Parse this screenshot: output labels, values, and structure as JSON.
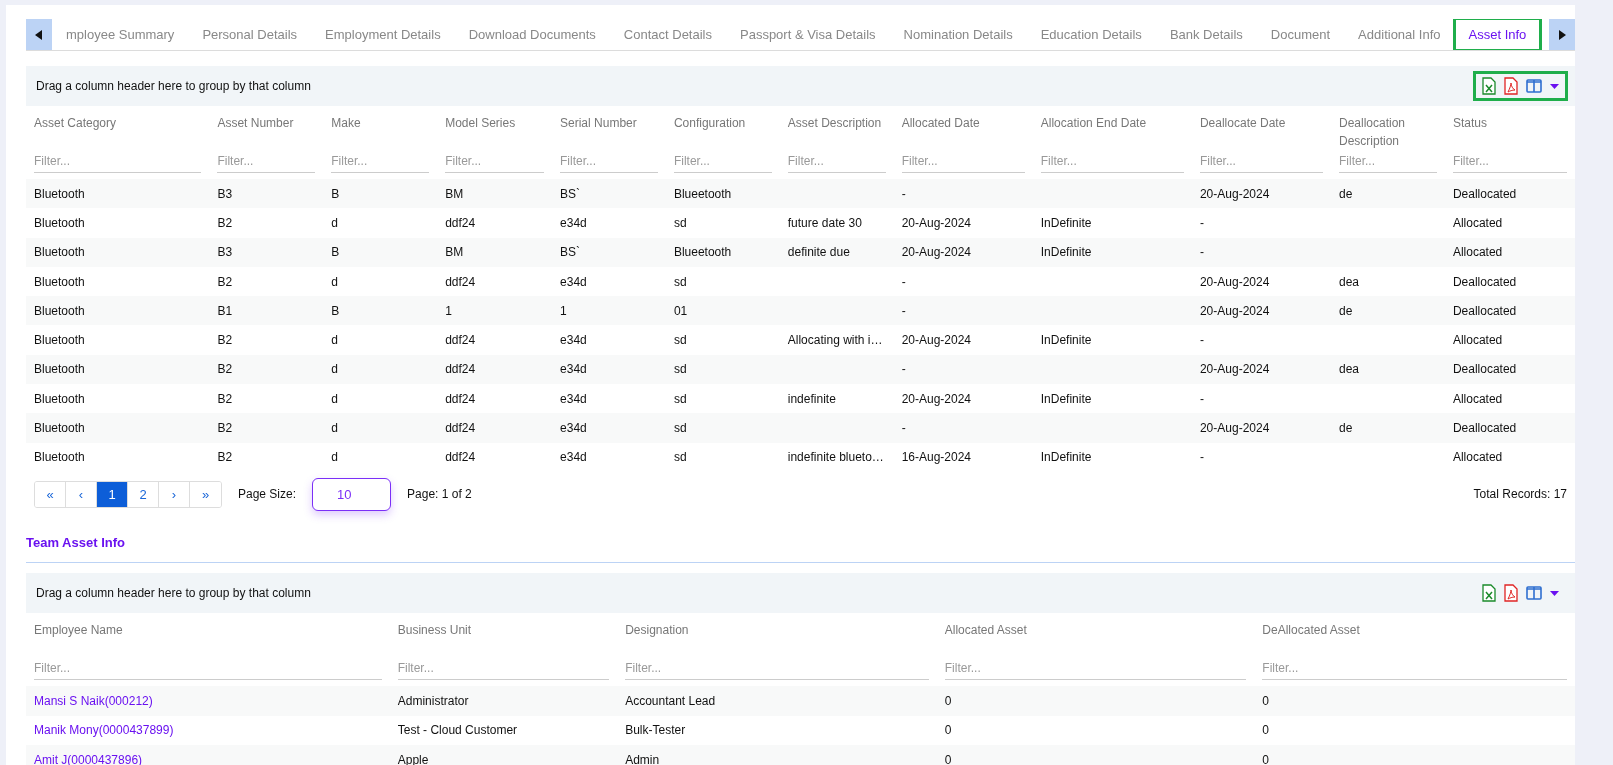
{
  "tabs": {
    "items": [
      {
        "label": "mployee Summary",
        "selected": false,
        "highlighted": false
      },
      {
        "label": "Personal Details",
        "selected": false,
        "highlighted": false
      },
      {
        "label": "Employment Details",
        "selected": false,
        "highlighted": false
      },
      {
        "label": "Download Documents",
        "selected": false,
        "highlighted": false
      },
      {
        "label": "Contact Details",
        "selected": false,
        "highlighted": false
      },
      {
        "label": "Passport & Visa Details",
        "selected": false,
        "highlighted": false
      },
      {
        "label": "Nomination Details",
        "selected": false,
        "highlighted": false
      },
      {
        "label": "Education Details",
        "selected": false,
        "highlighted": false
      },
      {
        "label": "Bank Details",
        "selected": false,
        "highlighted": false
      },
      {
        "label": "Document",
        "selected": false,
        "highlighted": false
      },
      {
        "label": "Additional Info",
        "selected": false,
        "highlighted": false
      },
      {
        "label": "Asset Info",
        "selected": true,
        "highlighted": true
      }
    ]
  },
  "asset_grid": {
    "group_hint": "Drag a column header here to group by that column",
    "toolbar": {
      "highlighted": true
    },
    "columns": [
      {
        "label": "Asset Category",
        "filter_placeholder": "Filter..."
      },
      {
        "label": "Asset Number",
        "filter_placeholder": "Filter..."
      },
      {
        "label": "Make",
        "filter_placeholder": "Filter..."
      },
      {
        "label": "Model Series",
        "filter_placeholder": "Filter..."
      },
      {
        "label": "Serial Number",
        "filter_placeholder": "Filter..."
      },
      {
        "label": "Configuration",
        "filter_placeholder": "Filter..."
      },
      {
        "label": "Asset Description",
        "filter_placeholder": "Filter..."
      },
      {
        "label": "Allocated Date",
        "filter_placeholder": "Filter..."
      },
      {
        "label": "Allocation End Date",
        "filter_placeholder": "Filter..."
      },
      {
        "label": "Deallocate Date",
        "filter_placeholder": "Filter..."
      },
      {
        "label": "Deallocation Description",
        "filter_placeholder": "Filter..."
      },
      {
        "label": "Status",
        "filter_placeholder": "Filter..."
      }
    ],
    "rows": [
      [
        "Bluetooth",
        "B3",
        "B",
        "BM",
        "BS`",
        "Blueetooth",
        "",
        "-",
        "",
        "20-Aug-2024",
        "de",
        "Deallocated"
      ],
      [
        "Bluetooth",
        "B2",
        "d",
        "ddf24",
        "e34d",
        "sd",
        "future date 30",
        "20-Aug-2024",
        "InDefinite",
        "-",
        "",
        "Allocated"
      ],
      [
        "Bluetooth",
        "B3",
        "B",
        "BM",
        "BS`",
        "Blueetooth",
        "definite due",
        "20-Aug-2024",
        "InDefinite",
        "-",
        "",
        "Allocated"
      ],
      [
        "Bluetooth",
        "B2",
        "d",
        "ddf24",
        "e34d",
        "sd",
        "",
        "-",
        "",
        "20-Aug-2024",
        "dea",
        "Deallocated"
      ],
      [
        "Bluetooth",
        "B1",
        "B",
        "1",
        "1",
        "01",
        "",
        "-",
        "",
        "20-Aug-2024",
        "de",
        "Deallocated"
      ],
      [
        "Bluetooth",
        "B2",
        "d",
        "ddf24",
        "e34d",
        "sd",
        "Allocating with i…",
        "20-Aug-2024",
        "InDefinite",
        "-",
        "",
        "Allocated"
      ],
      [
        "Bluetooth",
        "B2",
        "d",
        "ddf24",
        "e34d",
        "sd",
        "",
        "-",
        "",
        "20-Aug-2024",
        "dea",
        "Deallocated"
      ],
      [
        "Bluetooth",
        "B2",
        "d",
        "ddf24",
        "e34d",
        "sd",
        "indefinite",
        "20-Aug-2024",
        "InDefinite",
        "-",
        "",
        "Allocated"
      ],
      [
        "Bluetooth",
        "B2",
        "d",
        "ddf24",
        "e34d",
        "sd",
        "",
        "-",
        "",
        "20-Aug-2024",
        "de",
        "Deallocated"
      ],
      [
        "Bluetooth",
        "B2",
        "d",
        "ddf24",
        "e34d",
        "sd",
        "indefinite blueto…",
        "16-Aug-2024",
        "InDefinite",
        "-",
        "",
        "Allocated"
      ]
    ],
    "pagination": {
      "buttons": [
        {
          "label": "«",
          "selected": false
        },
        {
          "label": "‹",
          "selected": false
        },
        {
          "label": "1",
          "selected": true
        },
        {
          "label": "2",
          "selected": false
        },
        {
          "label": "›",
          "selected": false
        },
        {
          "label": "»",
          "selected": false
        }
      ],
      "page_size_label": "Page Size:",
      "page_size": "10",
      "page_info": "Page: 1 of 2",
      "total": "Total Records: 17"
    }
  },
  "team_section": {
    "title": "Team Asset Info"
  },
  "team_grid": {
    "group_hint": "Drag a column header here to group by that column",
    "toolbar": {
      "highlighted": false
    },
    "columns": [
      {
        "label": "Employee Name",
        "filter_placeholder": "Filter...",
        "kind": "link"
      },
      {
        "label": "Business Unit",
        "filter_placeholder": "Filter...",
        "kind": "text"
      },
      {
        "label": "Designation",
        "filter_placeholder": "Filter...",
        "kind": "text"
      },
      {
        "label": "Allocated Asset",
        "filter_placeholder": "Filter...",
        "kind": "text"
      },
      {
        "label": "DeAllocated Asset",
        "filter_placeholder": "Filter...",
        "kind": "text"
      }
    ],
    "rows": [
      [
        "Mansi S Naik(000212)",
        "Administrator",
        "Accountant Lead",
        "0",
        "0"
      ],
      [
        "Manik Mony(0000437899)",
        "Test - Cloud Customer",
        "Bulk-Tester",
        "0",
        "0"
      ],
      [
        "Amit J(0000437896)",
        "Apple",
        "Admin",
        "0",
        "0"
      ]
    ]
  }
}
